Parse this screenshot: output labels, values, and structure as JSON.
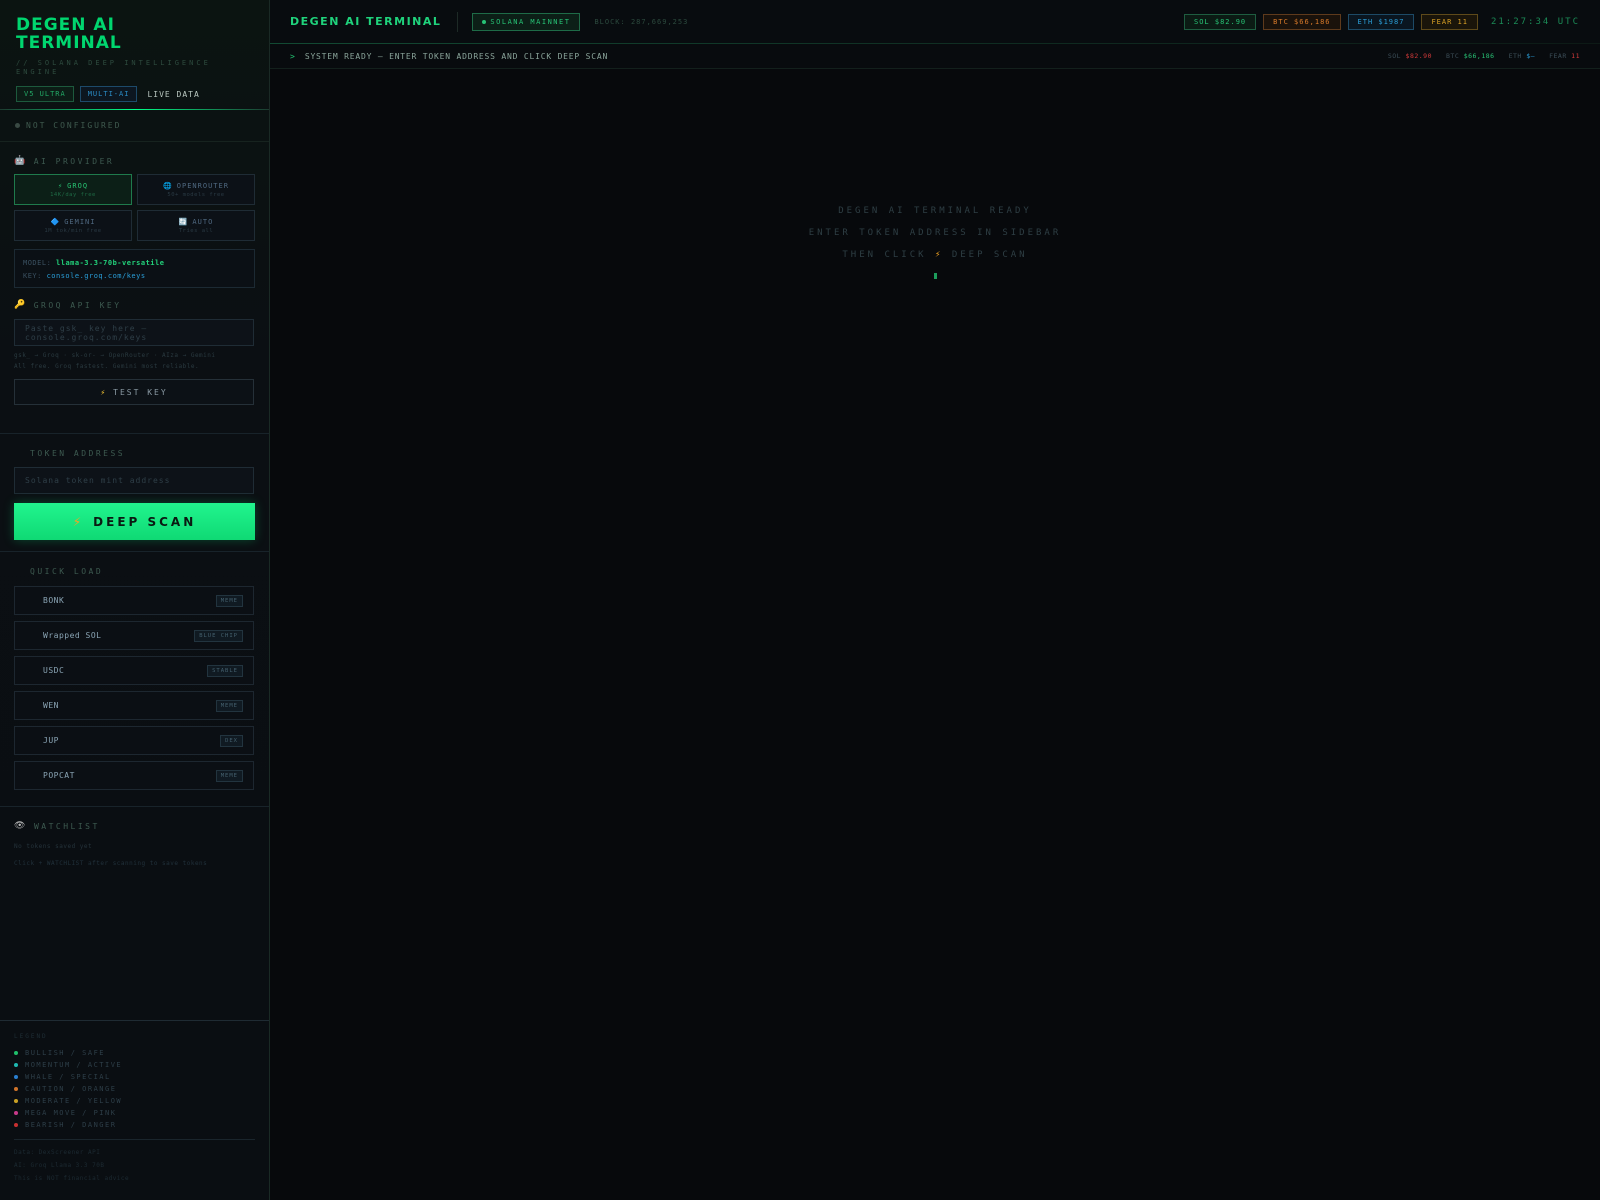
{
  "sidebar": {
    "brand_title": "DEGEN AI TERMINAL",
    "brand_subtitle": "// SOLANA DEEP INTELLIGENCE ENGINE",
    "badges": [
      "V5 ULTRA",
      "MULTI-AI",
      "LIVE DATA"
    ],
    "config_status": "NOT CONFIGURED",
    "ai_provider_label": "AI PROVIDER",
    "providers": [
      {
        "icon": "⚡",
        "name": "GROQ",
        "desc": "14K/day free"
      },
      {
        "icon": "🌐",
        "name": "OPENROUTER",
        "desc": "50+ models free"
      },
      {
        "icon": "🔷",
        "name": "GEMINI",
        "desc": "1M tok/min free"
      },
      {
        "icon": "🔄",
        "name": "AUTO",
        "desc": "Tries all"
      }
    ],
    "model_label": "MODEL:",
    "model_value": "llama-3.3-70b-versatile",
    "key_link_label": "KEY:",
    "key_link_value": "console.groq.com/keys",
    "api_key_label": "GROQ API KEY",
    "api_key_placeholder": "Paste gsk_ key here — console.groq.com/keys",
    "api_key_hint_1": "gsk_ → Groq · sk-or- → OpenRouter · AIza → Gemini",
    "api_key_hint_2": "All free. Groq fastest. Gemini most reliable.",
    "test_key_label": "TEST KEY",
    "token_label": "TOKEN ADDRESS",
    "token_placeholder": "Solana token mint address",
    "deep_scan_label": "DEEP SCAN",
    "quick_load_label": "QUICK LOAD",
    "quick_items": [
      {
        "name": "BONK",
        "tag": "MEME"
      },
      {
        "name": "Wrapped SOL",
        "tag": "BLUE CHIP"
      },
      {
        "name": "USDC",
        "tag": "STABLE"
      },
      {
        "name": "WEN",
        "tag": "MEME"
      },
      {
        "name": "JUP",
        "tag": "DEX"
      },
      {
        "name": "POPCAT",
        "tag": "MEME"
      }
    ],
    "watchlist_label": "WATCHLIST",
    "watchlist_empty": "No tokens saved yet",
    "watchlist_hint": "Click + WATCHLIST after scanning to save tokens",
    "legend_title": "LEGEND",
    "legend": [
      {
        "label": "BULLISH / SAFE",
        "color": "#1fbf6a"
      },
      {
        "label": "MOMENTUM / ACTIVE",
        "color": "#1fb8b0"
      },
      {
        "label": "WHALE / SPECIAL",
        "color": "#2a7fd0"
      },
      {
        "label": "CAUTION / ORANGE",
        "color": "#d0742a"
      },
      {
        "label": "MODERATE / YELLOW",
        "color": "#c9a025"
      },
      {
        "label": "MEGA MOVE / PINK",
        "color": "#c83a8a"
      },
      {
        "label": "BEARISH / DANGER",
        "color": "#c83030"
      }
    ],
    "footer": [
      "Data: DexScreener API",
      "AI: Groq Llama 3.3 70B",
      "This is NOT financial advice"
    ]
  },
  "topbar": {
    "title": "DEGEN AI TERMINAL",
    "network": "SOLANA MAINNET",
    "block": "BLOCK: 287,669,253",
    "prices": {
      "sol": "SOL $82.90",
      "btc": "BTC $66,186",
      "eth": "ETH $1987",
      "fear": "FEAR 11"
    },
    "clock": "21:27:34 UTC"
  },
  "statusbar": {
    "prompt": ">",
    "message": "SYSTEM READY — ENTER TOKEN ADDRESS AND CLICK DEEP SCAN",
    "sol_label": "SOL",
    "sol_value": "$82.90",
    "btc_label": "BTC",
    "btc_value": "$66,186",
    "eth_label": "ETH",
    "eth_value": "$—",
    "fear_label": "FEAR",
    "fear_value": "11"
  },
  "center": {
    "line1": "DEGEN AI TERMINAL READY",
    "line2": "ENTER TOKEN ADDRESS IN SIDEBAR",
    "line3_pre": "THEN CLICK",
    "line3_icon": "⚡",
    "line3_post": "DEEP SCAN"
  },
  "icons": {
    "robot": "🤖",
    "key": "🔑",
    "eye": "👁",
    "bolt": "⚡"
  }
}
